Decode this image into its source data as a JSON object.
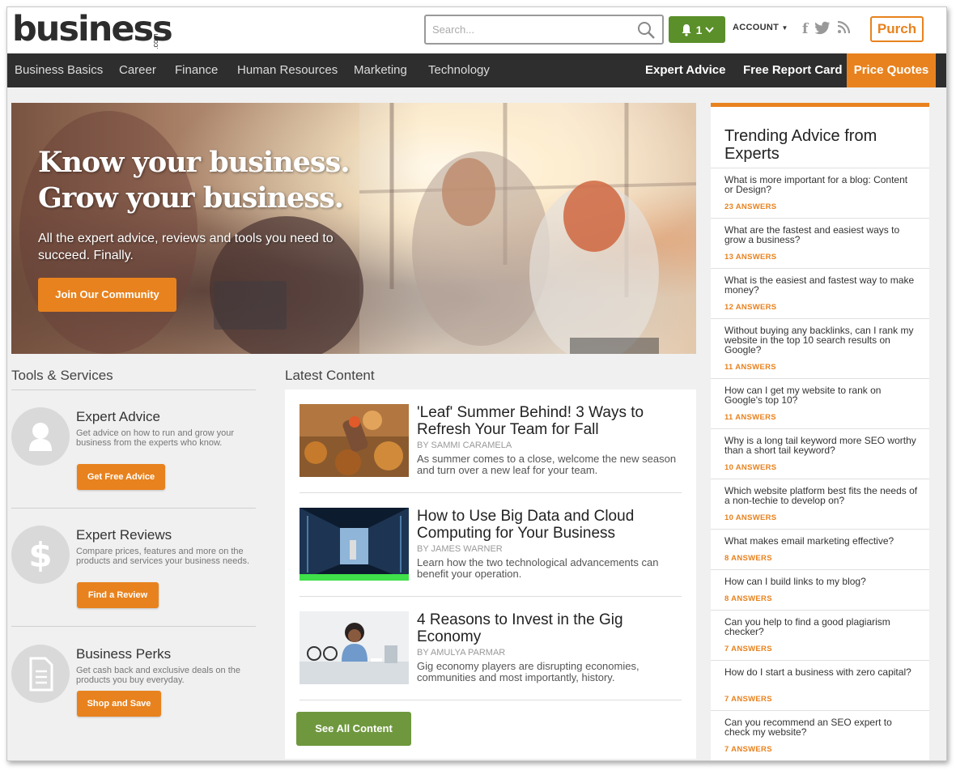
{
  "header": {
    "logo_text": "business",
    "logo_suffix": ".com",
    "search_placeholder": "Search...",
    "notification_count": "1",
    "account_label": "ACCOUNT",
    "purch_label": "Purch"
  },
  "nav": {
    "items": [
      "Business Basics",
      "Career",
      "Finance",
      "Human Resources",
      "Marketing",
      "Technology"
    ],
    "right_items": [
      "Expert Advice",
      "Free Report Card"
    ],
    "highlight": "Price Quotes"
  },
  "hero": {
    "line1": "Know your business.",
    "line2": "Grow your business.",
    "subtitle": "All the expert advice, reviews and tools you need to succeed. Finally.",
    "button": "Join Our Community"
  },
  "tools": {
    "heading": "Tools & Services",
    "items": [
      {
        "title": "Expert Advice",
        "desc": "Get advice on how to run and grow your business from the experts who know.",
        "button": "Get Free Advice",
        "icon": "person-icon"
      },
      {
        "title": "Expert Reviews",
        "desc": "Compare prices, features and more on the products and services your business needs.",
        "button": "Find a Review",
        "icon": "dollar-icon"
      },
      {
        "title": "Business Perks",
        "desc": "Get cash back and exclusive deals on the products you buy everyday.",
        "button": "Shop and Save",
        "icon": "document-icon"
      }
    ]
  },
  "latest": {
    "heading": "Latest Content",
    "articles": [
      {
        "title": "'Leaf' Summer Behind! 3 Ways to Refresh Your Team for Fall",
        "byline": "BY SAMMI CARAMELA",
        "desc": "As summer comes to a close, welcome the new season and turn over a new leaf for your team."
      },
      {
        "title": "How to Use Big Data and Cloud Computing for Your Business",
        "byline": "BY JAMES WARNER",
        "desc": "Learn how the two technological advancements can benefit your operation."
      },
      {
        "title": "4 Reasons to Invest in the Gig Economy",
        "byline": "BY AMULYA PARMAR",
        "desc": "Gig economy players are disrupting economies, communities and most importantly, history."
      }
    ],
    "see_all": "See All Content"
  },
  "trending": {
    "heading": "Trending Advice from Experts",
    "items": [
      {
        "q": "What is more important for a blog: Content or Design?",
        "a": "23 ANSWERS"
      },
      {
        "q": "What are the fastest and easiest ways to grow a business?",
        "a": "13 ANSWERS"
      },
      {
        "q": "What is the easiest and fastest way to make money?",
        "a": "12 ANSWERS"
      },
      {
        "q": "Without buying any backlinks, can I rank my website in the top 10 search results on Google?",
        "a": "11 ANSWERS"
      },
      {
        "q": "How can I get my website to rank on Google's top 10?",
        "a": "11 ANSWERS"
      },
      {
        "q": "Why is a long tail keyword more SEO worthy than a short tail keyword?",
        "a": "10 ANSWERS"
      },
      {
        "q": "Which website platform best fits the needs of a non-techie to develop on?",
        "a": "10 ANSWERS"
      },
      {
        "q": "What makes email marketing effective?",
        "a": "8 ANSWERS"
      },
      {
        "q": "How can I build links to my blog?",
        "a": "8 ANSWERS"
      },
      {
        "q": "Can you help to find a good plagiarism checker?",
        "a": "7 ANSWERS"
      },
      {
        "q": "How do I start a business with zero capital?",
        "a": "7 ANSWERS"
      },
      {
        "q": "Can you recommend an SEO expert to check my website?",
        "a": "7 ANSWERS"
      }
    ]
  },
  "colors": {
    "accent": "#e8821e",
    "nav_bg": "#2e2e2e",
    "green": "#5a8f29",
    "see_all_green": "#6f983e"
  }
}
